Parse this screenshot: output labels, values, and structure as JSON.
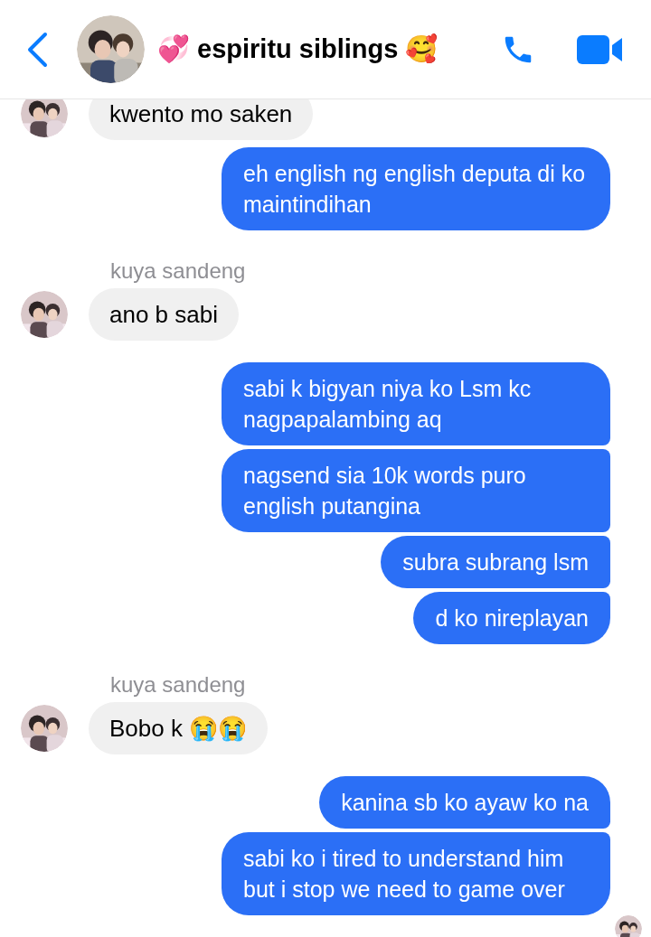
{
  "header": {
    "title": "💞 espiritu siblings 🥰"
  },
  "messages": [
    {
      "kind": "incoming",
      "text": "kwento mo saken"
    },
    {
      "kind": "outgoing",
      "text": "eh english ng english deputa di ko maintindihan"
    },
    {
      "kind": "sender",
      "text": "kuya sandeng"
    },
    {
      "kind": "incoming",
      "text": "ano b sabi"
    },
    {
      "kind": "outgoing",
      "text": "sabi k bigyan niya ko Lsm kc nagpapalambing aq"
    },
    {
      "kind": "outgoing",
      "text": "nagsend sia 10k words puro english putangina"
    },
    {
      "kind": "outgoing",
      "text": "subra subrang lsm"
    },
    {
      "kind": "outgoing",
      "text": "d ko nireplayan"
    },
    {
      "kind": "sender",
      "text": "kuya sandeng"
    },
    {
      "kind": "incoming",
      "text": "Bobo k 😭😭"
    },
    {
      "kind": "outgoing",
      "text": "kanina sb ko ayaw ko na"
    },
    {
      "kind": "outgoing",
      "text": "sabi ko i tired to understand him but i stop we need to game over"
    }
  ]
}
